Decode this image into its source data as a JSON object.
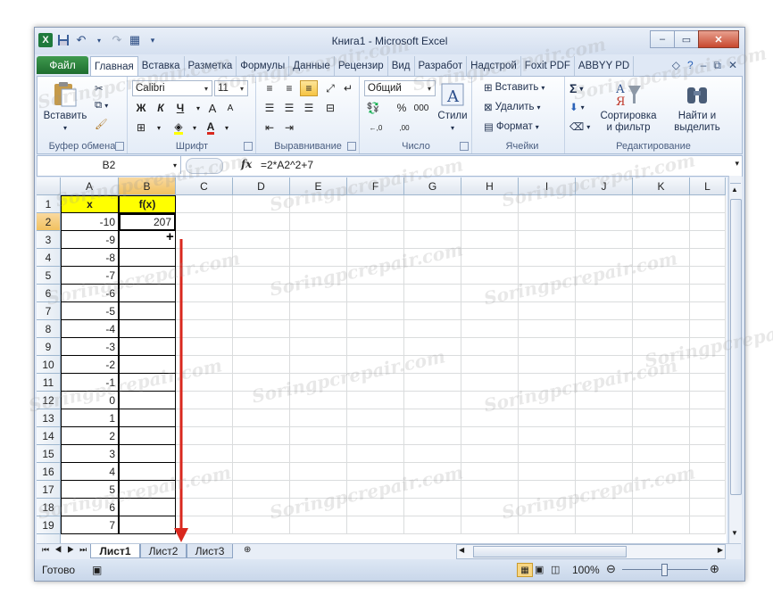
{
  "window": {
    "title": "Книга1 - Microsoft Excel",
    "controls": {
      "minimize": "–",
      "restore": "▭",
      "close": "✕"
    }
  },
  "quick_access": [
    "save-icon",
    "undo-icon",
    "redo-icon"
  ],
  "tabs": {
    "file": "Файл",
    "items": [
      "Главная",
      "Вставка",
      "Разметка",
      "Формулы",
      "Данные",
      "Рецензир",
      "Вид",
      "Разработ",
      "Надстрой",
      "Foxit PDF",
      "ABBYY PD"
    ],
    "active_index": 0
  },
  "ribbon": {
    "clipboard": {
      "paste": "Вставить",
      "label": "Буфер обмена"
    },
    "font": {
      "name": "Calibri",
      "size": "11",
      "bold": "Ж",
      "italic": "К",
      "underline": "Ч",
      "grow": "A",
      "shrink": "A",
      "label": "Шрифт"
    },
    "alignment": {
      "label": "Выравнивание"
    },
    "number": {
      "format": "Общий",
      "percent": "%",
      "thousands": "000",
      "inc": "←,0",
      "dec": ",00",
      "label": "Число"
    },
    "styles": {
      "label": "Стили"
    },
    "cells": {
      "insert": "Вставить",
      "delete": "Удалить",
      "format": "Формат",
      "label": "Ячейки"
    },
    "editing": {
      "sigma": "Σ",
      "sort_line1": "Сортировка",
      "sort_line2": "и фильтр",
      "find_line1": "Найти и",
      "find_line2": "выделить",
      "label": "Редактирование"
    }
  },
  "formula_bar": {
    "name_box": "B2",
    "fx": "fx",
    "formula": "=2*A2^2+7"
  },
  "columns": [
    "A",
    "B",
    "C",
    "D",
    "E",
    "F",
    "G",
    "H",
    "I",
    "J",
    "K",
    "L"
  ],
  "rows": [
    "1",
    "2",
    "3",
    "4",
    "5",
    "6",
    "7",
    "8",
    "9",
    "10",
    "11",
    "12",
    "13",
    "14",
    "15",
    "16",
    "17",
    "18",
    "19"
  ],
  "cells": {
    "A1": "x",
    "B1": "f(x)",
    "B2": "207",
    "x_values": [
      "-10",
      "-9",
      "-8",
      "-7",
      "-6",
      "-5",
      "-4",
      "-3",
      "-2",
      "-1",
      "0",
      "1",
      "2",
      "3",
      "4",
      "5",
      "6",
      "7"
    ]
  },
  "sheets": [
    "Лист1",
    "Лист2",
    "Лист3"
  ],
  "active_sheet": 0,
  "status": {
    "ready": "Готово",
    "zoom": "100%"
  },
  "watermark": "Soringpcrepair.com",
  "colors": {
    "header_fill": "#ffff00",
    "arrow": "#d9281e",
    "file_tab": "#2a7d3a"
  }
}
